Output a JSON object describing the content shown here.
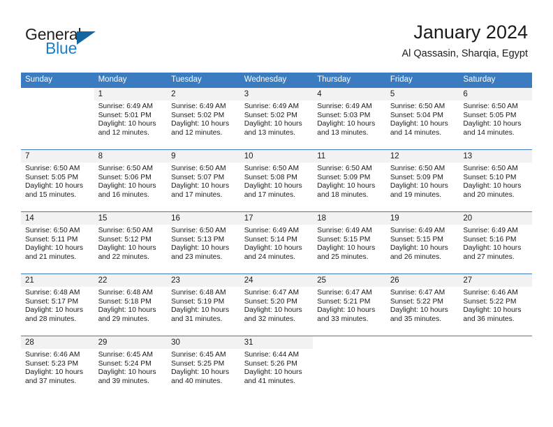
{
  "logo": {
    "text_primary": "General",
    "text_secondary": "Blue",
    "primary_color": "#231f20",
    "secondary_color": "#1b7ec4",
    "triangle_color": "#12659e"
  },
  "header": {
    "title": "January 2024",
    "location": "Al Qassasin, Sharqia, Egypt"
  },
  "theme": {
    "header_bg": "#3b7cc0",
    "header_text": "#ffffff",
    "daynum_bg": "#f2f2f2",
    "cell_bg": "#ffffff",
    "row_border": "#3b7cc0"
  },
  "weekdays": [
    "Sunday",
    "Monday",
    "Tuesday",
    "Wednesday",
    "Thursday",
    "Friday",
    "Saturday"
  ],
  "weeks": [
    [
      {
        "day": "",
        "sunrise": "",
        "sunset": "",
        "daylight1": "",
        "daylight2": "",
        "empty": true
      },
      {
        "day": "1",
        "sunrise": "Sunrise: 6:49 AM",
        "sunset": "Sunset: 5:01 PM",
        "daylight1": "Daylight: 10 hours",
        "daylight2": "and 12 minutes."
      },
      {
        "day": "2",
        "sunrise": "Sunrise: 6:49 AM",
        "sunset": "Sunset: 5:02 PM",
        "daylight1": "Daylight: 10 hours",
        "daylight2": "and 12 minutes."
      },
      {
        "day": "3",
        "sunrise": "Sunrise: 6:49 AM",
        "sunset": "Sunset: 5:02 PM",
        "daylight1": "Daylight: 10 hours",
        "daylight2": "and 13 minutes."
      },
      {
        "day": "4",
        "sunrise": "Sunrise: 6:49 AM",
        "sunset": "Sunset: 5:03 PM",
        "daylight1": "Daylight: 10 hours",
        "daylight2": "and 13 minutes."
      },
      {
        "day": "5",
        "sunrise": "Sunrise: 6:50 AM",
        "sunset": "Sunset: 5:04 PM",
        "daylight1": "Daylight: 10 hours",
        "daylight2": "and 14 minutes."
      },
      {
        "day": "6",
        "sunrise": "Sunrise: 6:50 AM",
        "sunset": "Sunset: 5:05 PM",
        "daylight1": "Daylight: 10 hours",
        "daylight2": "and 14 minutes."
      }
    ],
    [
      {
        "day": "7",
        "sunrise": "Sunrise: 6:50 AM",
        "sunset": "Sunset: 5:05 PM",
        "daylight1": "Daylight: 10 hours",
        "daylight2": "and 15 minutes."
      },
      {
        "day": "8",
        "sunrise": "Sunrise: 6:50 AM",
        "sunset": "Sunset: 5:06 PM",
        "daylight1": "Daylight: 10 hours",
        "daylight2": "and 16 minutes."
      },
      {
        "day": "9",
        "sunrise": "Sunrise: 6:50 AM",
        "sunset": "Sunset: 5:07 PM",
        "daylight1": "Daylight: 10 hours",
        "daylight2": "and 17 minutes."
      },
      {
        "day": "10",
        "sunrise": "Sunrise: 6:50 AM",
        "sunset": "Sunset: 5:08 PM",
        "daylight1": "Daylight: 10 hours",
        "daylight2": "and 17 minutes."
      },
      {
        "day": "11",
        "sunrise": "Sunrise: 6:50 AM",
        "sunset": "Sunset: 5:09 PM",
        "daylight1": "Daylight: 10 hours",
        "daylight2": "and 18 minutes."
      },
      {
        "day": "12",
        "sunrise": "Sunrise: 6:50 AM",
        "sunset": "Sunset: 5:09 PM",
        "daylight1": "Daylight: 10 hours",
        "daylight2": "and 19 minutes."
      },
      {
        "day": "13",
        "sunrise": "Sunrise: 6:50 AM",
        "sunset": "Sunset: 5:10 PM",
        "daylight1": "Daylight: 10 hours",
        "daylight2": "and 20 minutes."
      }
    ],
    [
      {
        "day": "14",
        "sunrise": "Sunrise: 6:50 AM",
        "sunset": "Sunset: 5:11 PM",
        "daylight1": "Daylight: 10 hours",
        "daylight2": "and 21 minutes."
      },
      {
        "day": "15",
        "sunrise": "Sunrise: 6:50 AM",
        "sunset": "Sunset: 5:12 PM",
        "daylight1": "Daylight: 10 hours",
        "daylight2": "and 22 minutes."
      },
      {
        "day": "16",
        "sunrise": "Sunrise: 6:50 AM",
        "sunset": "Sunset: 5:13 PM",
        "daylight1": "Daylight: 10 hours",
        "daylight2": "and 23 minutes."
      },
      {
        "day": "17",
        "sunrise": "Sunrise: 6:49 AM",
        "sunset": "Sunset: 5:14 PM",
        "daylight1": "Daylight: 10 hours",
        "daylight2": "and 24 minutes."
      },
      {
        "day": "18",
        "sunrise": "Sunrise: 6:49 AM",
        "sunset": "Sunset: 5:15 PM",
        "daylight1": "Daylight: 10 hours",
        "daylight2": "and 25 minutes."
      },
      {
        "day": "19",
        "sunrise": "Sunrise: 6:49 AM",
        "sunset": "Sunset: 5:15 PM",
        "daylight1": "Daylight: 10 hours",
        "daylight2": "and 26 minutes."
      },
      {
        "day": "20",
        "sunrise": "Sunrise: 6:49 AM",
        "sunset": "Sunset: 5:16 PM",
        "daylight1": "Daylight: 10 hours",
        "daylight2": "and 27 minutes."
      }
    ],
    [
      {
        "day": "21",
        "sunrise": "Sunrise: 6:48 AM",
        "sunset": "Sunset: 5:17 PM",
        "daylight1": "Daylight: 10 hours",
        "daylight2": "and 28 minutes."
      },
      {
        "day": "22",
        "sunrise": "Sunrise: 6:48 AM",
        "sunset": "Sunset: 5:18 PM",
        "daylight1": "Daylight: 10 hours",
        "daylight2": "and 29 minutes."
      },
      {
        "day": "23",
        "sunrise": "Sunrise: 6:48 AM",
        "sunset": "Sunset: 5:19 PM",
        "daylight1": "Daylight: 10 hours",
        "daylight2": "and 31 minutes."
      },
      {
        "day": "24",
        "sunrise": "Sunrise: 6:47 AM",
        "sunset": "Sunset: 5:20 PM",
        "daylight1": "Daylight: 10 hours",
        "daylight2": "and 32 minutes."
      },
      {
        "day": "25",
        "sunrise": "Sunrise: 6:47 AM",
        "sunset": "Sunset: 5:21 PM",
        "daylight1": "Daylight: 10 hours",
        "daylight2": "and 33 minutes."
      },
      {
        "day": "26",
        "sunrise": "Sunrise: 6:47 AM",
        "sunset": "Sunset: 5:22 PM",
        "daylight1": "Daylight: 10 hours",
        "daylight2": "and 35 minutes."
      },
      {
        "day": "27",
        "sunrise": "Sunrise: 6:46 AM",
        "sunset": "Sunset: 5:22 PM",
        "daylight1": "Daylight: 10 hours",
        "daylight2": "and 36 minutes."
      }
    ],
    [
      {
        "day": "28",
        "sunrise": "Sunrise: 6:46 AM",
        "sunset": "Sunset: 5:23 PM",
        "daylight1": "Daylight: 10 hours",
        "daylight2": "and 37 minutes."
      },
      {
        "day": "29",
        "sunrise": "Sunrise: 6:45 AM",
        "sunset": "Sunset: 5:24 PM",
        "daylight1": "Daylight: 10 hours",
        "daylight2": "and 39 minutes."
      },
      {
        "day": "30",
        "sunrise": "Sunrise: 6:45 AM",
        "sunset": "Sunset: 5:25 PM",
        "daylight1": "Daylight: 10 hours",
        "daylight2": "and 40 minutes."
      },
      {
        "day": "31",
        "sunrise": "Sunrise: 6:44 AM",
        "sunset": "Sunset: 5:26 PM",
        "daylight1": "Daylight: 10 hours",
        "daylight2": "and 41 minutes."
      },
      {
        "day": "",
        "sunrise": "",
        "sunset": "",
        "daylight1": "",
        "daylight2": "",
        "empty": true
      },
      {
        "day": "",
        "sunrise": "",
        "sunset": "",
        "daylight1": "",
        "daylight2": "",
        "empty": true
      },
      {
        "day": "",
        "sunrise": "",
        "sunset": "",
        "daylight1": "",
        "daylight2": "",
        "empty": true
      }
    ]
  ]
}
